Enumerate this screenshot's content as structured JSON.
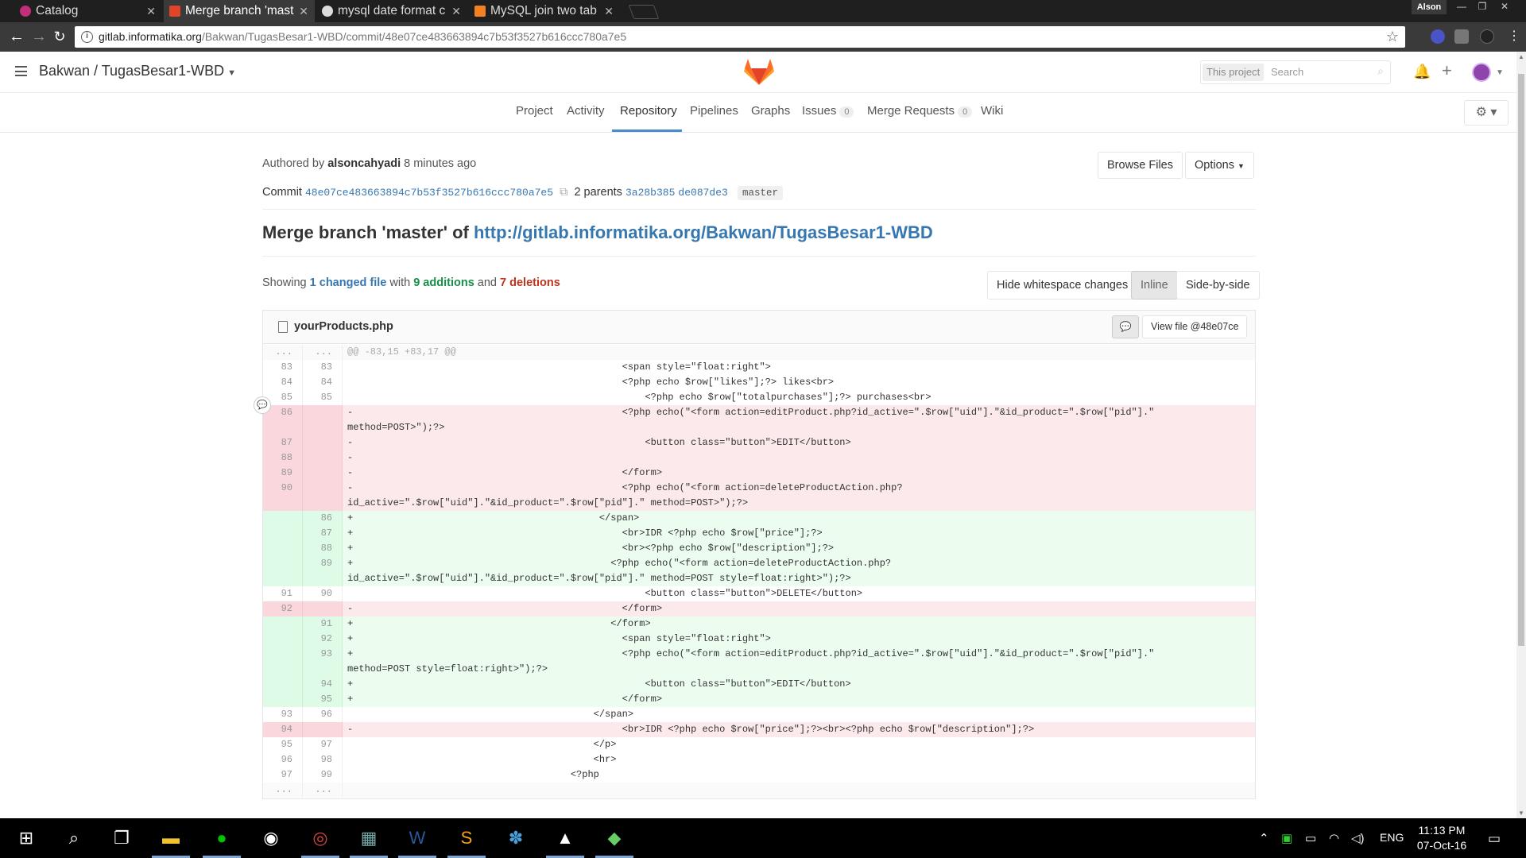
{
  "browser": {
    "tabs": [
      {
        "title": "Catalog",
        "fav_color": "#c0307a"
      },
      {
        "title": "Merge branch 'mast",
        "fav_color": "#e24329"
      },
      {
        "title": "mysql date format c",
        "fav_color": "#dcdcdc"
      },
      {
        "title": "MySQL join two tab",
        "fav_color": "#f48024"
      }
    ],
    "profile_name": "Alson",
    "url_host": "gitlab.informatika.org",
    "url_path": "/Bakwan/TugasBesar1-WBD/commit/48e07ce483663894c7b53f3527b616ccc780a7e5"
  },
  "header": {
    "project_title": "Bakwan / TugasBesar1-WBD",
    "search_scope": "This project",
    "search_placeholder": "Search"
  },
  "subnav": {
    "project": "Project",
    "activity": "Activity",
    "repository": "Repository",
    "pipelines": "Pipelines",
    "graphs": "Graphs",
    "issues": "Issues",
    "issues_count": "0",
    "merge_requests": "Merge Requests",
    "merge_requests_count": "0",
    "wiki": "Wiki"
  },
  "commit": {
    "authored_prefix": "Authored by",
    "author": "alsoncahyadi",
    "time_ago": "8 minutes ago",
    "browse_files": "Browse Files",
    "options": "Options",
    "commit_label": "Commit",
    "sha": "48e07ce483663894c7b53f3527b616ccc780a7e5",
    "parents_label": "2 parents",
    "parent1": "3a28b385",
    "parent2": "de087de3",
    "branch": "master",
    "title_text": "Merge branch 'master' of ",
    "title_link": "http://gitlab.informatika.org/Bakwan/TugasBesar1-WBD"
  },
  "stats": {
    "showing": "Showing",
    "changed": "1 changed file",
    "with": "with",
    "additions": "9 additions",
    "and": "and",
    "deletions": "7 deletions",
    "hide_ws": "Hide whitespace changes",
    "inline": "Inline",
    "side_by_side": "Side-by-side"
  },
  "file": {
    "name": "yourProducts.php",
    "view_file": "View file @48e07ce"
  },
  "diff_lines": [
    {
      "type": "match",
      "o": "...",
      "n": "...",
      "c": "@@ -83,15 +83,17 @@"
    },
    {
      "type": "ctx",
      "o": "83",
      "n": "83",
      "c": "                                                <span style=\"float:right\">"
    },
    {
      "type": "ctx",
      "o": "84",
      "n": "84",
      "c": "                                                <?php echo $row[\"likes\"];?> likes<br>"
    },
    {
      "type": "ctx",
      "o": "85",
      "n": "85",
      "c": "                                                    <?php echo $row[\"totalpurchases\"];?> purchases<br>"
    },
    {
      "type": "old",
      "o": "86",
      "n": "",
      "c": "-                                               <?php echo(\"<form action=editProduct.php?id_active=\".$row[\"uid\"].\"&id_product=\".$row[\"pid\"].\"\nmethod=POST>\");?>"
    },
    {
      "type": "old",
      "o": "87",
      "n": "",
      "c": "-                                                   <button class=\"button\">EDIT</button>"
    },
    {
      "type": "old",
      "o": "88",
      "n": "",
      "c": "-"
    },
    {
      "type": "old",
      "o": "89",
      "n": "",
      "c": "-                                               </form>"
    },
    {
      "type": "old",
      "o": "90",
      "n": "",
      "c": "-                                               <?php echo(\"<form action=deleteProductAction.php?\nid_active=\".$row[\"uid\"].\"&id_product=\".$row[\"pid\"].\" method=POST>\");?>"
    },
    {
      "type": "new",
      "o": "",
      "n": "86",
      "c": "+                                           </span>"
    },
    {
      "type": "new",
      "o": "",
      "n": "87",
      "c": "+                                               <br>IDR <?php echo $row[\"price\"];?>"
    },
    {
      "type": "new",
      "o": "",
      "n": "88",
      "c": "+                                               <br><?php echo $row[\"description\"];?>"
    },
    {
      "type": "new",
      "o": "",
      "n": "89",
      "c": "+                                             <?php echo(\"<form action=deleteProductAction.php?\nid_active=\".$row[\"uid\"].\"&id_product=\".$row[\"pid\"].\" method=POST style=float:right>\");?>"
    },
    {
      "type": "ctx",
      "o": "91",
      "n": "90",
      "c": "                                                    <button class=\"button\">DELETE</button>"
    },
    {
      "type": "old",
      "o": "92",
      "n": "",
      "c": "-                                               </form>"
    },
    {
      "type": "new",
      "o": "",
      "n": "91",
      "c": "+                                             </form>"
    },
    {
      "type": "new",
      "o": "",
      "n": "92",
      "c": "+                                               <span style=\"float:right\">"
    },
    {
      "type": "new",
      "o": "",
      "n": "93",
      "c": "+                                               <?php echo(\"<form action=editProduct.php?id_active=\".$row[\"uid\"].\"&id_product=\".$row[\"pid\"].\"\nmethod=POST style=float:right>\");?>"
    },
    {
      "type": "new",
      "o": "",
      "n": "94",
      "c": "+                                                   <button class=\"button\">EDIT</button>"
    },
    {
      "type": "new",
      "o": "",
      "n": "95",
      "c": "+                                               </form>"
    },
    {
      "type": "ctx",
      "o": "93",
      "n": "96",
      "c": "                                           </span>"
    },
    {
      "type": "old",
      "o": "94",
      "n": "",
      "c": "-                                               <br>IDR <?php echo $row[\"price\"];?><br><?php echo $row[\"description\"];?>"
    },
    {
      "type": "ctx",
      "o": "95",
      "n": "97",
      "c": "                                           </p>"
    },
    {
      "type": "ctx",
      "o": "96",
      "n": "98",
      "c": "                                           <hr>"
    },
    {
      "type": "ctx",
      "o": "97",
      "n": "99",
      "c": "                                       <?php"
    },
    {
      "type": "match",
      "o": "...",
      "n": "...",
      "c": ""
    }
  ],
  "taskbar": {
    "lang": "ENG",
    "time": "11:13 PM",
    "date": "07-Oct-16"
  }
}
